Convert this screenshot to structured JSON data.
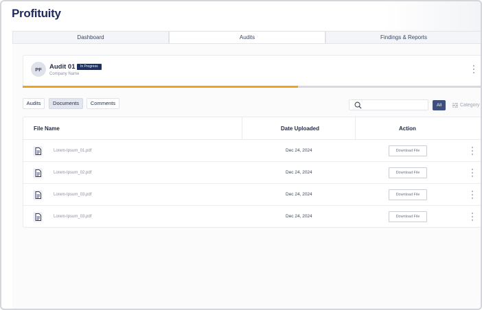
{
  "app": {
    "title": "Profituity"
  },
  "tabs": [
    {
      "label": "Dashboard",
      "active": false
    },
    {
      "label": "Audits",
      "active": true
    },
    {
      "label": "Findings & Reports",
      "active": false
    }
  ],
  "audit": {
    "avatar_initials": "PF",
    "title": "Audit 01",
    "status": "In Progress",
    "company": "Company Name",
    "progress": 0.6,
    "progress_color": "#f0a21b"
  },
  "subtabs": [
    {
      "label": "Audits",
      "active": false
    },
    {
      "label": "Documents",
      "active": true
    },
    {
      "label": "Comments",
      "active": false
    }
  ],
  "filters": {
    "search_placeholder": "",
    "all_label": "All",
    "category_label": "Category"
  },
  "table": {
    "headers": {
      "file_name": "File Name",
      "date_uploaded": "Date Uploaded",
      "action": "Action"
    },
    "rows": [
      {
        "file_name": "Lorem-Ipsum_01.pdf",
        "date": "Dec 24, 2024",
        "action": "Download File"
      },
      {
        "file_name": "Lorem-Ipsum_02.pdf",
        "date": "Dec 24, 2024",
        "action": "Download File"
      },
      {
        "file_name": "Lorem-Ipsum_03.pdf",
        "date": "Dec 24, 2024",
        "action": "Download File"
      },
      {
        "file_name": "Lorem-Ipsum_03.pdf",
        "date": "Dec 24, 2024",
        "action": "Download File"
      }
    ]
  },
  "colors": {
    "brand": "#1f2a5c",
    "badge": "#1f3163",
    "accent": "#f0a21b",
    "all_button": "#3e4f7c"
  },
  "icons": {
    "file": "document-icon",
    "search": "search-icon",
    "menu": "kebab-menu-icon",
    "category": "filter-icon"
  }
}
